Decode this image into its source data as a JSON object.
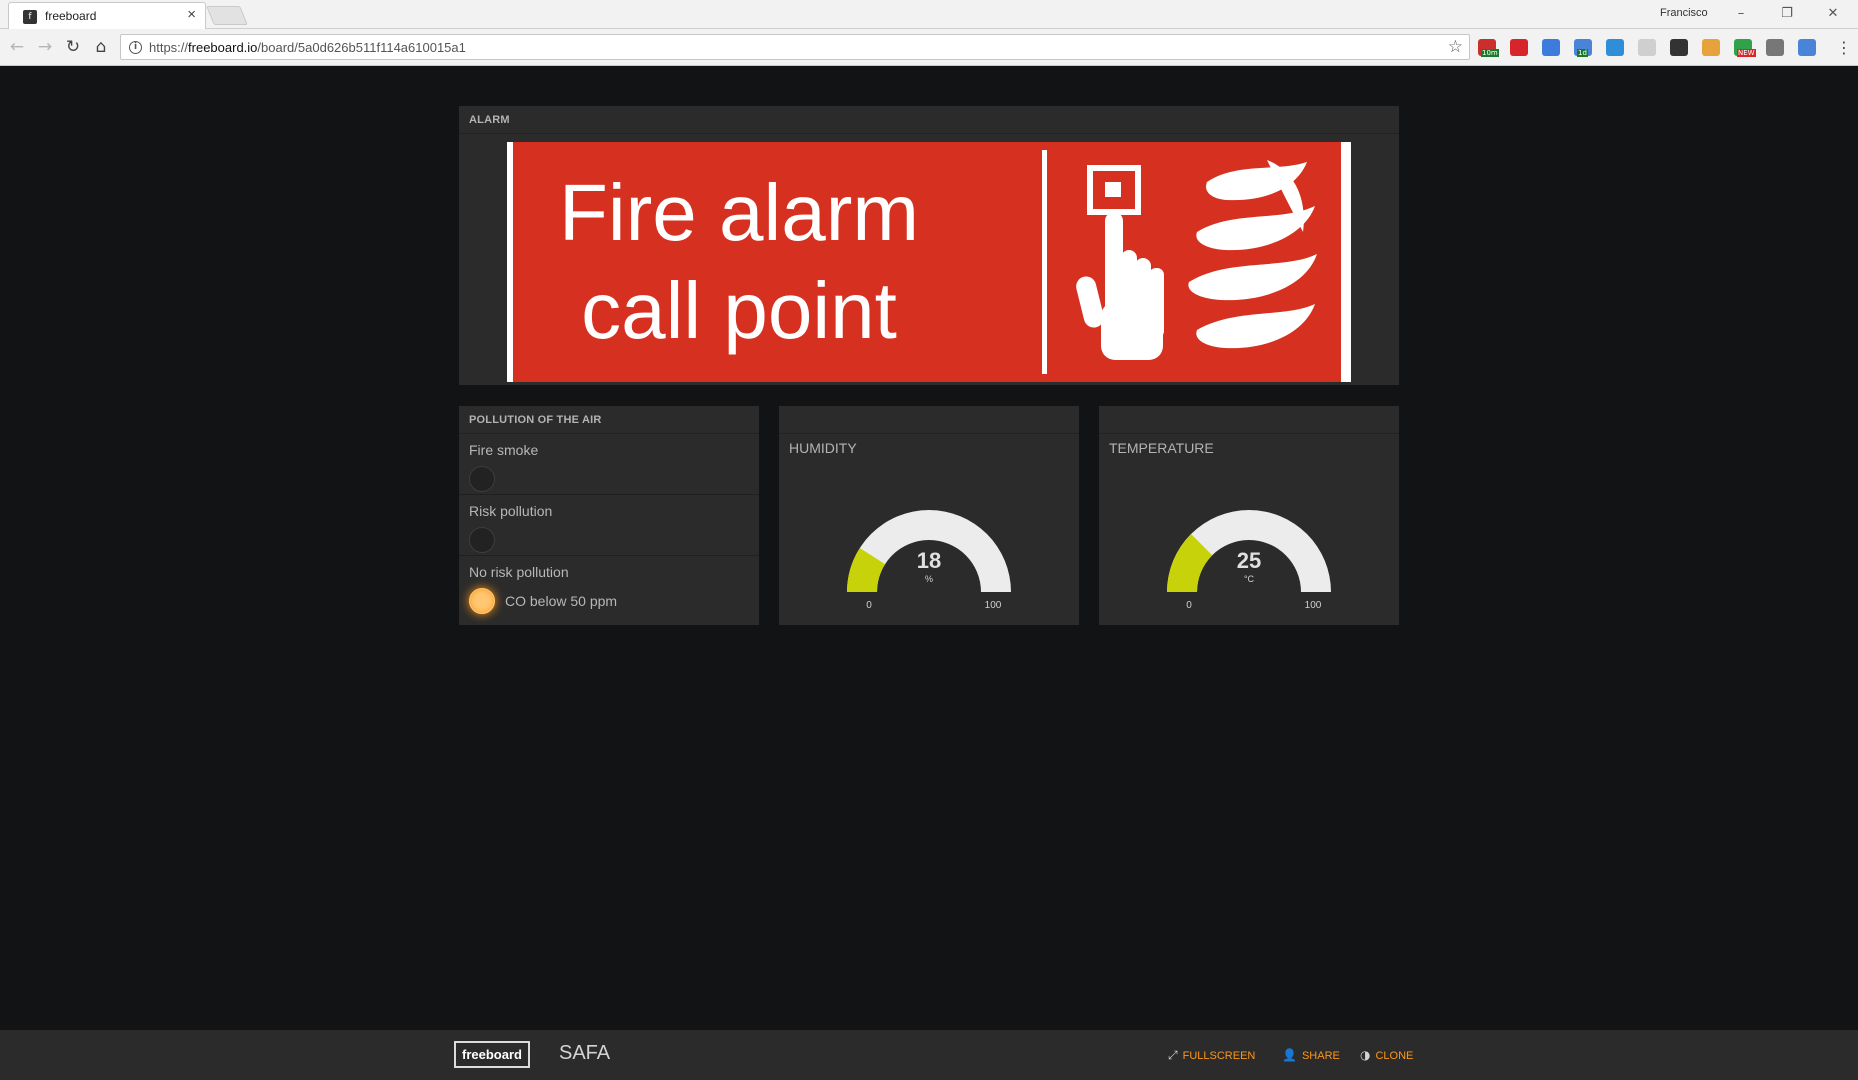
{
  "browser": {
    "tab_title": "freeboard",
    "tab_favicon": "f",
    "tab_close": "×",
    "user_name": "Francisco",
    "url_host": "freeboard.io",
    "url_prefix": "https://",
    "url_path": "/board/5a0d626b511f114a610015a1",
    "extensions": [
      {
        "icon": "ext-rss-icon",
        "badge": "10m",
        "color": "#c9302c"
      },
      {
        "icon": "ext-gear-red-icon",
        "color": "#d7262b"
      },
      {
        "icon": "ext-translate-icon",
        "color": "#3d7cdc"
      },
      {
        "icon": "ext-calendar-icon",
        "badge": "1d",
        "color": "#4a84d8"
      },
      {
        "icon": "ext-window-icon",
        "color": "#2e8fd8"
      },
      {
        "icon": "ext-ghost-icon",
        "color": "#cfcfcf"
      },
      {
        "icon": "ext-speed-icon",
        "color": "#333333"
      },
      {
        "icon": "ext-rainbow-icon",
        "color": "#e8a23b"
      },
      {
        "icon": "ext-new-icon",
        "badge": "NEW",
        "color": "#2fa24a"
      },
      {
        "icon": "ext-folder-icon",
        "color": "#777777"
      },
      {
        "icon": "ext-schedule-icon",
        "color": "#4a84d8"
      }
    ]
  },
  "panels": {
    "alarm": {
      "title": "ALARM",
      "image_text_line1": "Fire alarm",
      "image_text_line2": "call point"
    },
    "pollution": {
      "title": "POLLUTION OF THE AIR",
      "indicators": [
        {
          "label": "Fire smoke",
          "on": false,
          "text": ""
        },
        {
          "label": "Risk pollution",
          "on": false,
          "text": ""
        },
        {
          "label": "No risk pollution",
          "on": true,
          "text": "CO below 50 ppm"
        }
      ]
    },
    "humidity": {
      "title": "HUMIDITY",
      "value": 18,
      "units": "%",
      "min": 0,
      "max": 100,
      "min_label": "0",
      "max_label": "100",
      "value_label": "18"
    },
    "temperature": {
      "title": "TEMPERATURE",
      "value": 25,
      "units": "°C",
      "min": 0,
      "max": 100,
      "min_label": "0",
      "max_label": "100",
      "value_label": "25"
    }
  },
  "colors": {
    "gauge_fill": "#c8d20a",
    "gauge_track": "#ececec",
    "indicator_on": "#ffc773",
    "footer_link": "#ff9618",
    "alarm_red": "#d63120"
  },
  "footer": {
    "brand": "freeboard",
    "board_name": "SAFA",
    "links": [
      "FULLSCREEN",
      "SHARE",
      "CLONE"
    ]
  }
}
